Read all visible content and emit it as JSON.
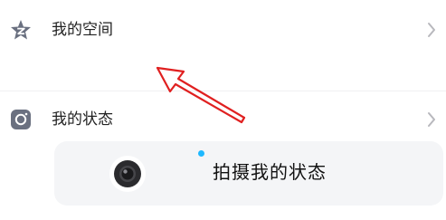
{
  "menu": {
    "my_space": {
      "label": "我的空间",
      "icon": "qzone-star-icon"
    },
    "my_status": {
      "label": "我的状态",
      "icon": "camera-lens-icon"
    }
  },
  "status_card": {
    "label": "拍摄我的状态",
    "icon": "camera-icon",
    "dot_color": "#1eb8ff"
  },
  "annotation": {
    "arrow_color": "#e02020"
  }
}
